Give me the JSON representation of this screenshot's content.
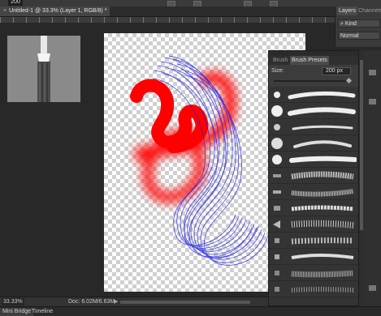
{
  "options_bar": {
    "brush_size": "200"
  },
  "document": {
    "tab_title": "Untitled-1 @ 33.3% (Layer 1, RGB/8) *",
    "close_glyph": "×"
  },
  "status_bar": {
    "zoom": "33.33%",
    "doc_info": "Doc: 6.02M/6.63M",
    "arrow": "▶"
  },
  "bottom_tabs": [
    "Mini Bridge",
    "Timeline"
  ],
  "layers_panel": {
    "tabs": [
      "Layers",
      "Channels"
    ],
    "filter_kind": "Kind",
    "blend_mode": "Normal"
  },
  "brush_panel": {
    "tabs": [
      "Brush",
      "Brush Presets"
    ],
    "size_label": "Size:",
    "size_value": "200 px"
  },
  "colors": {
    "paint_red": "#ff0000",
    "paint_blue": "#1a1ae6",
    "panel_bg": "#3c3c3c",
    "workspace_bg": "#282828"
  }
}
